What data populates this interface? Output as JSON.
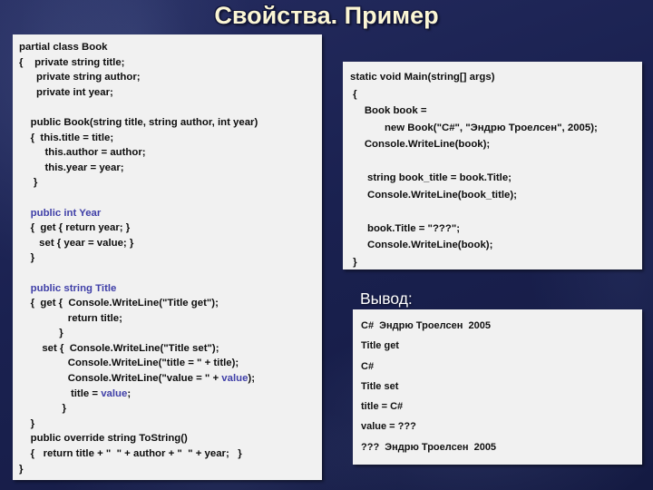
{
  "slide": {
    "title": "Свойства. Пример",
    "background_color": "#1b2252",
    "title_color": "#fbf6d4",
    "panel_bg_color": "#f1f1f1",
    "keyword_color": "#4040a8"
  },
  "left_panel": {
    "name": "book-class-code",
    "lines": [
      [
        {
          "t": "partial class Book",
          "k": false
        }
      ],
      [
        {
          "t": "{    private string title;",
          "k": false
        }
      ],
      [
        {
          "t": "      private string author;",
          "k": false
        }
      ],
      [
        {
          "t": "      private int year;",
          "k": false
        }
      ],
      [],
      [
        {
          "t": "    public Book(string title, string author, int year)",
          "k": false
        }
      ],
      [
        {
          "t": "    {  this.title = title;",
          "k": false
        }
      ],
      [
        {
          "t": "         this.author = author;",
          "k": false
        }
      ],
      [
        {
          "t": "         this.year = year;",
          "k": false
        }
      ],
      [
        {
          "t": "     }",
          "k": false
        }
      ],
      [],
      [
        {
          "t": "    public int Year",
          "k": true
        }
      ],
      [
        {
          "t": "    {  get { return year; }",
          "k": false
        }
      ],
      [
        {
          "t": "       set { year = value; }",
          "k": false
        }
      ],
      [
        {
          "t": "    }",
          "k": false
        }
      ],
      [],
      [
        {
          "t": "    public string Title",
          "k": true
        }
      ],
      [
        {
          "t": "    {  get {  Console.WriteLine(\"Title get\");",
          "k": false
        }
      ],
      [
        {
          "t": "                 return title;",
          "k": false
        }
      ],
      [
        {
          "t": "              }",
          "k": false
        }
      ],
      [
        {
          "t": "        set {  Console.WriteLine(\"Title set\");",
          "k": false
        }
      ],
      [
        {
          "t": "                 Console.WriteLine(\"title = \" + title);",
          "k": false
        }
      ],
      [
        {
          "t": "                 Console.WriteLine(\"value = \" + ",
          "k": false
        },
        {
          "t": "value",
          "k": true
        },
        {
          "t": ");",
          "k": false
        }
      ],
      [
        {
          "t": "                  title = ",
          "k": false
        },
        {
          "t": "value",
          "k": true
        },
        {
          "t": ";",
          "k": false
        }
      ],
      [
        {
          "t": "               }",
          "k": false
        }
      ],
      [
        {
          "t": "    }",
          "k": false
        }
      ],
      [
        {
          "t": "    public override string ToString()",
          "k": false
        }
      ],
      [
        {
          "t": "    {   return title + \"  \" + author + \"  \" + year;   }",
          "k": false
        }
      ],
      [
        {
          "t": "}",
          "k": false
        }
      ]
    ]
  },
  "right_panel": {
    "name": "main-method-code",
    "lines": [
      [
        {
          "t": "static void Main(string[] args)",
          "k": false
        }
      ],
      [
        {
          "t": " {",
          "k": false
        }
      ],
      [
        {
          "t": "     Book book =",
          "k": false
        }
      ],
      [
        {
          "t": "            new Book(\"C#\", \"Эндрю Троелсен\", 2005);",
          "k": false
        }
      ],
      [
        {
          "t": "     Console.WriteLine(book);",
          "k": false
        }
      ],
      [],
      [
        {
          "t": "      string book_title = book.Title;",
          "k": false
        }
      ],
      [
        {
          "t": "      Console.WriteLine(book_title);",
          "k": false
        }
      ],
      [],
      [
        {
          "t": "      book.Title = \"???\";",
          "k": false
        }
      ],
      [
        {
          "t": "      Console.WriteLine(book);",
          "k": false
        }
      ],
      [
        {
          "t": " }",
          "k": false
        }
      ]
    ]
  },
  "output": {
    "label": "Вывод:",
    "lines": [
      "C#  Эндрю Троелсен  2005",
      "Title get",
      "C#",
      "Title set",
      "title = C#",
      "value = ???",
      "???  Эндрю Троелсен  2005"
    ]
  }
}
